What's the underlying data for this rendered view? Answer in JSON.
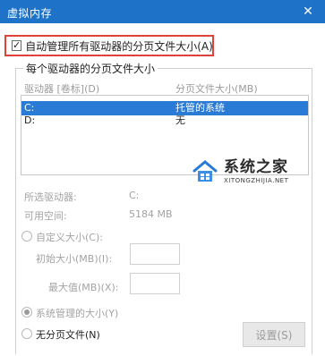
{
  "window": {
    "title": "虚拟内存",
    "close_glyph": "✕"
  },
  "auto_manage": {
    "checked": true,
    "label": "自动管理所有驱动器的分页文件大小(A)"
  },
  "group": {
    "title": "每个驱动器的分页文件大小"
  },
  "drive_list": {
    "columns": [
      "驱动器 [卷标](D)",
      "分页文件大小(MB)"
    ],
    "rows": [
      {
        "drive": "C:",
        "size": "托管的系统",
        "selected": true
      },
      {
        "drive": "D:",
        "size": "无",
        "selected": false
      }
    ]
  },
  "watermark": {
    "text": "系统之家",
    "sub": "XITONGZHIJIA.NET"
  },
  "info": {
    "selected_drive_label": "所选驱动器:",
    "selected_drive_value": "C:",
    "free_space_label": "可用空间:",
    "free_space_value": "5184 MB"
  },
  "options": {
    "custom_label": "自定义大小(C):",
    "initial_label": "初始大小(MB)(I):",
    "max_label": "最大值(MB)(X):",
    "system_managed_label": "系统管理的大小(Y)",
    "no_paging_label": "无分页文件(N)",
    "set_button": "设置(S)"
  },
  "colors": {
    "title_bar": "#1e73c9",
    "highlight": "#e0413a",
    "selection": "#2a7bd6"
  }
}
